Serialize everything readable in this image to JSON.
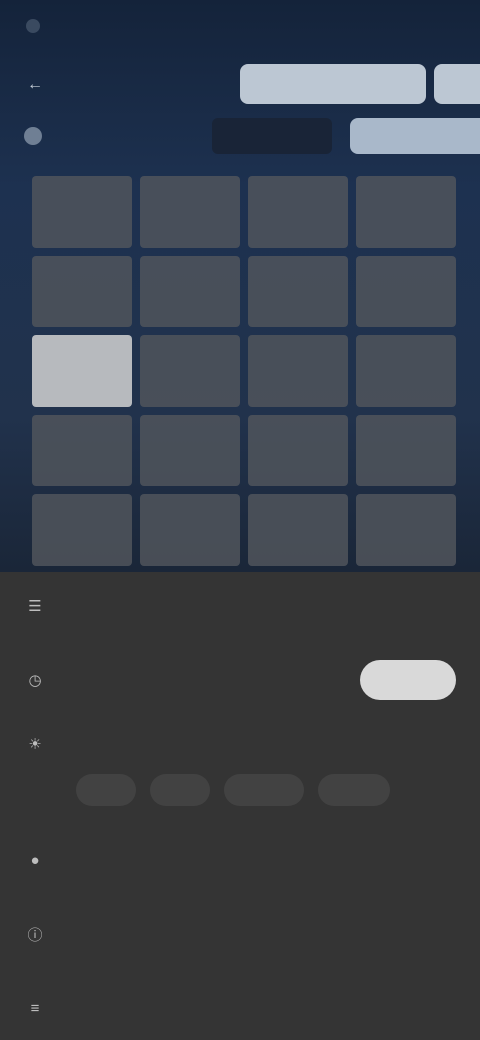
{
  "topbar": {
    "title": "",
    "right_text": ""
  },
  "header": {
    "back_icon": "arrow-left-icon",
    "label": "",
    "actions": [
      "",
      ""
    ]
  },
  "filterbar": {
    "text": "",
    "chip": "",
    "button": ""
  },
  "grid": {
    "selected_index": 8,
    "cells": [
      "",
      "",
      "",
      "",
      "",
      "",
      "",
      "",
      "",
      "",
      "",
      "",
      "",
      "",
      "",
      "",
      "",
      "",
      "",
      ""
    ]
  },
  "panel": {
    "row1": {
      "icon": "layers-icon",
      "label": ""
    },
    "row2": {
      "icon": "clock-icon",
      "label": "",
      "toggle": ""
    },
    "row3": {
      "icon": "sun-icon",
      "label": "",
      "value": ""
    },
    "chips": [
      "",
      "",
      "",
      ""
    ],
    "row4": {
      "icon": "circle-icon",
      "label": ""
    },
    "row5": {
      "icon": "info-icon",
      "label": ""
    },
    "row6": {
      "icon": "list-icon",
      "label": ""
    }
  }
}
